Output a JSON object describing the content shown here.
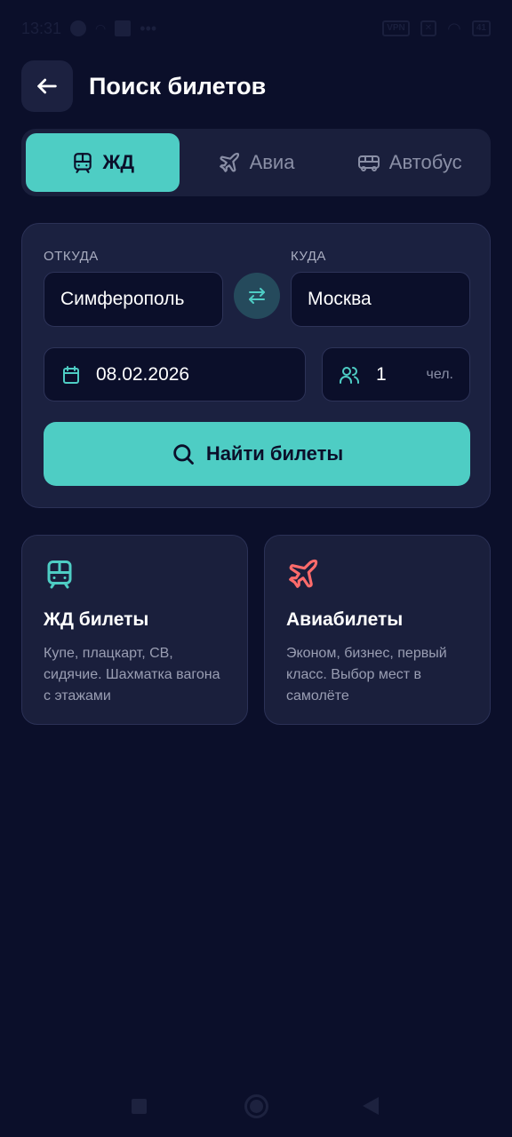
{
  "status_bar": {
    "time": "13:31",
    "dots": "•••",
    "vpn": "VPN",
    "battery": "41"
  },
  "header": {
    "title": "Поиск билетов",
    "back_icon": "arrow-left-icon"
  },
  "tabs": [
    {
      "label": "ЖД",
      "icon": "train-icon",
      "active": true
    },
    {
      "label": "Авиа",
      "icon": "plane-icon",
      "active": false
    },
    {
      "label": "Автобус",
      "icon": "bus-icon",
      "active": false
    }
  ],
  "search": {
    "from_label": "ОТКУДА",
    "from_value": "Симферополь",
    "to_label": "КУДА",
    "to_value": "Москва",
    "date_value": "08.02.2026",
    "passengers_value": "1",
    "passengers_unit": "чел.",
    "search_button": "Найти билеты"
  },
  "info_cards": [
    {
      "title": "ЖД билеты",
      "desc": "Купе, плацкарт, СВ, сидячие. Шахматка вагона с этажами",
      "icon": "train-icon",
      "color": "#4ecdc4"
    },
    {
      "title": "Авиабилеты",
      "desc": "Эконом, бизнес, первый класс. Выбор мест в самолёте",
      "icon": "plane-icon",
      "color": "#ff6b6b"
    }
  ],
  "colors": {
    "background": "#0b0f2a",
    "accent": "#4ecdc4",
    "danger": "#ff6b6b",
    "card": "#1b2140"
  }
}
